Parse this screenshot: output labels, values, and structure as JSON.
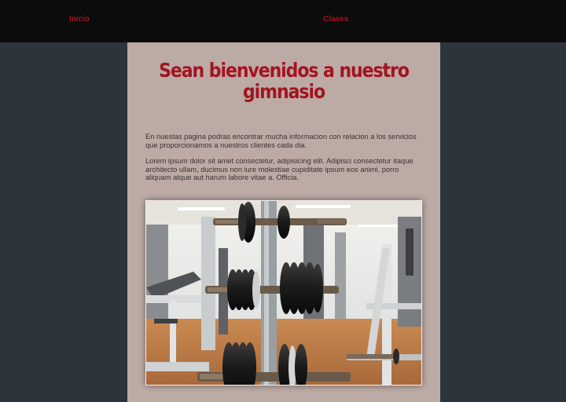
{
  "nav": {
    "items": [
      {
        "label": "Inicio"
      },
      {
        "label": "Clases"
      }
    ]
  },
  "main": {
    "title": "Sean bienvenidos a nuestro gimnasio",
    "paragraphs": [
      "En nuestas pagina podras encontrar mucha informacion con relacion a los servicios que proporcionamos a nuestros clientes cada dia.",
      "Lorem ipsum dolor sit amet consectetur, adipisicing elit. Adipisci consectetur itaque architecto ullam, ducimus non iure molestiae cupiditate ipsum eos animi, porro aliquam atque aut harum labore vitae a. Officia."
    ]
  },
  "colors": {
    "background": "#2d343b",
    "navbar": "#0c0c0c",
    "panel": "#bcaaa5",
    "accent": "#a3141f"
  }
}
